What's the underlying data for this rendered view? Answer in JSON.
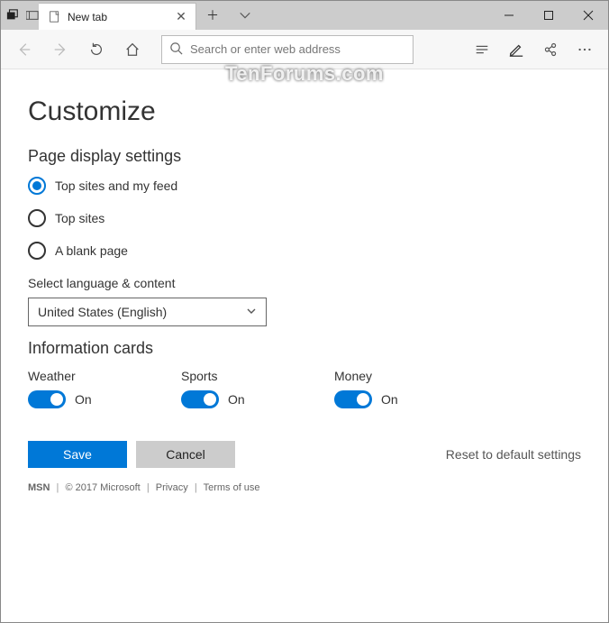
{
  "titlebar": {
    "tab_title": "New tab"
  },
  "toolbar": {
    "search_placeholder": "Search or enter web address"
  },
  "watermark": "TenForums.com",
  "page": {
    "heading": "Customize",
    "page_display_heading": "Page display settings",
    "radios": [
      {
        "label": "Top sites and my feed",
        "checked": true
      },
      {
        "label": "Top sites",
        "checked": false
      },
      {
        "label": "A blank page",
        "checked": false
      }
    ],
    "lang_label": "Select language & content",
    "lang_value": "United States (English)",
    "cards_heading": "Information cards",
    "cards": [
      {
        "label": "Weather",
        "state": "On"
      },
      {
        "label": "Sports",
        "state": "On"
      },
      {
        "label": "Money",
        "state": "On"
      }
    ],
    "save_label": "Save",
    "cancel_label": "Cancel",
    "reset_label": "Reset to default settings"
  },
  "footer": {
    "msn": "MSN",
    "copyright": "© 2017 Microsoft",
    "privacy": "Privacy",
    "terms": "Terms of use"
  }
}
